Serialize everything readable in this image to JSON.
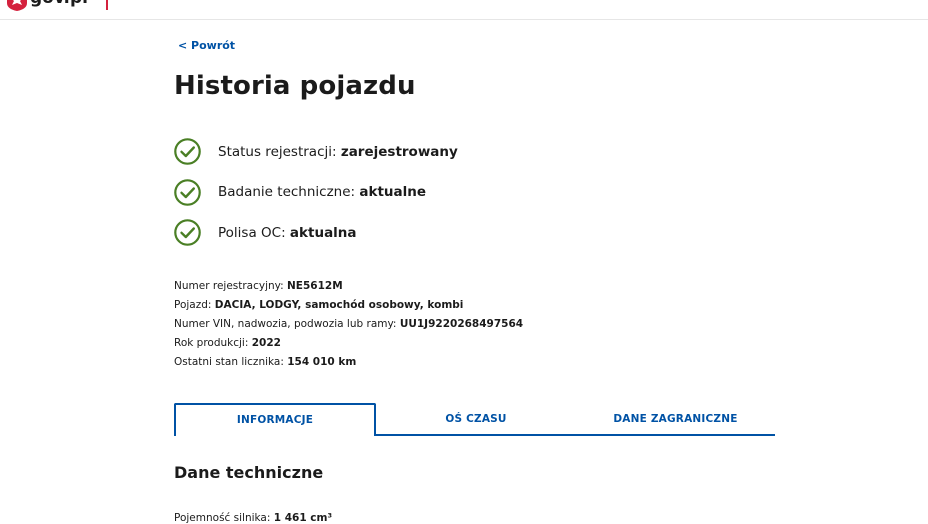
{
  "header": {
    "logo_text": "gov.pl",
    "top_crumb": "… › …"
  },
  "nav": {
    "back_label": "< Powrót"
  },
  "page_title": "Historia pojazdu",
  "status": [
    {
      "label": "Status rejestracji:",
      "value": "zarejestrowany"
    },
    {
      "label": "Badanie techniczne:",
      "value": "aktualne"
    },
    {
      "label": "Polisa OC:",
      "value": "aktualna"
    }
  ],
  "vehicle": [
    {
      "label": "Numer rejestracyjny:",
      "value": "NE5612M"
    },
    {
      "label": "Pojazd:",
      "value": "DACIA, LODGY, samochód osobowy, kombi"
    },
    {
      "label": "Numer VIN, nadwozia, podwozia lub ramy:",
      "value": "UU1J9220268497564"
    },
    {
      "label": "Rok produkcji:",
      "value": "2022"
    },
    {
      "label": "Ostatni stan licznika:",
      "value": "154 010 km"
    }
  ],
  "tabs": [
    {
      "label": "INFORMACJE",
      "active": true
    },
    {
      "label": "OŚ CZASU",
      "active": false
    },
    {
      "label": "DANE ZAGRANICZNE",
      "active": false
    }
  ],
  "section": {
    "title": "Dane techniczne",
    "first_row_label": "Pojemność silnika:",
    "first_row_value": "1 461 cm³"
  },
  "colors": {
    "accent": "#0052a5",
    "check": "#4a7f25",
    "brand_red": "#d4213d"
  },
  "icons": {
    "status": "check-circle-icon",
    "emblem": "eagle-emblem-icon"
  }
}
